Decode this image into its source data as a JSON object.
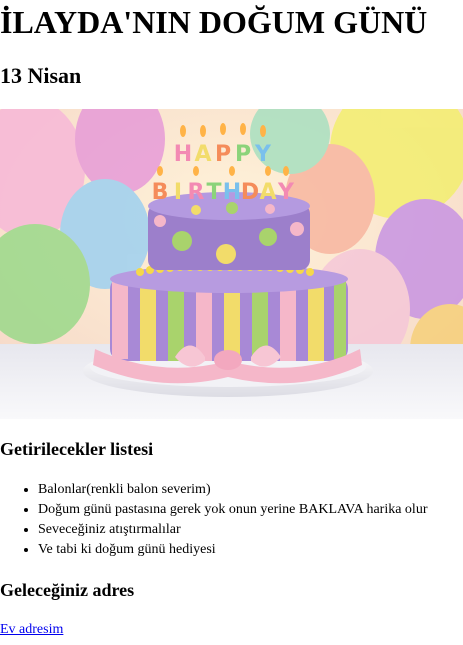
{
  "page": {
    "title": "İLAYDA'NIN DOĞUM GÜNÜ",
    "date": "13 Nisan"
  },
  "hero": {
    "icon": "birthday-cake-photo",
    "cake_text": "HAPPY BIRTHDAY",
    "colors": {
      "cake_body": "#a889d6",
      "top_tier": "#9c7fcb",
      "stripe_yellow": "#f2dc6a",
      "stripe_green": "#a9d36c",
      "ribbon_pink": "#f5b7c9",
      "balloon_yellow": "#f3ef6f",
      "balloon_green": "#9bd98a",
      "balloon_purple": "#c894e3",
      "background": "#ffe6b8"
    }
  },
  "list_section": {
    "heading": "Getirilecekler listesi",
    "items": [
      "Balonlar(renkli balon severim)",
      "Doğum günü pastasına gerek yok onun yerine BAKLAVA harika olur",
      "Seveceğiniz atıştırmalılar",
      "Ve tabi ki doğum günü hediyesi"
    ]
  },
  "address_section": {
    "heading": "Geleceğiniz adres",
    "link_text": "Ev adresim",
    "link_color": "#0000ee"
  }
}
